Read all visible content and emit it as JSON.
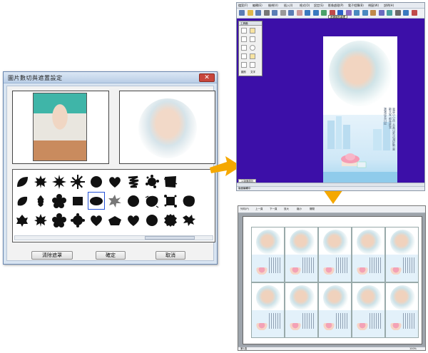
{
  "dialog": {
    "title": "圖片數切與遮置設定",
    "close_symbol": "✕",
    "buttons": {
      "clear_mask": "清除遮罩",
      "ok": "確定",
      "cancel": "取消"
    },
    "shapes_row1": [
      "leaf",
      "maple",
      "spiky-burst",
      "snowflake",
      "circle",
      "heart",
      "scribble",
      "splatter-flower",
      "grunge-square"
    ],
    "shapes_row2": [
      "round-leaf",
      "oak-leaf",
      "flower",
      "square",
      "ellipse",
      "star-burst",
      "circle",
      "brush-blob",
      "splatter-square",
      "grunge-blob"
    ],
    "shapes_row3": [
      "ivy-leaf",
      "maple",
      "flower",
      "cog-blob",
      "heart",
      "pentagon",
      "heart",
      "circle",
      "rough-circle",
      "splatter"
    ]
  },
  "app": {
    "menu": [
      "檔案(F)",
      "編輯(E)",
      "檢視(V)",
      "插入(I)",
      "格式(O)",
      "設定(S)",
      "影像處理(P)",
      "電子相簿(B)",
      "視窗(W)",
      "說明(H)"
    ],
    "tooltip": "遮罩圖形處理",
    "palette": {
      "title": "工具箱",
      "labels": [
        "圖形",
        "文字"
      ]
    },
    "poem": [
      "我是小小孩 天真可愛 活潑好動 喜歡大家 都來疼我",
      "寶寶成長日記"
    ],
    "tab": "1.版面設計",
    "status": "版面編輯中"
  },
  "preview": {
    "toolbar": [
      "列印(P)",
      "上一頁",
      "下一頁",
      "放大",
      "縮小",
      "關閉"
    ],
    "status_left": "第1頁",
    "status_right": "100%"
  },
  "colors": {
    "workspace": "#3c0fa8",
    "arrow": "#f5a800",
    "selection_outline": "#2452d6"
  }
}
